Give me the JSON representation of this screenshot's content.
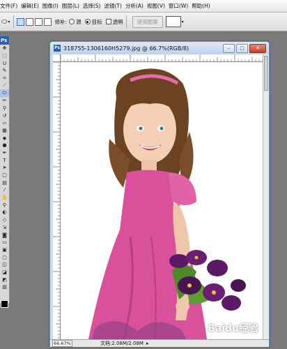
{
  "menu": [
    {
      "label": "文件(F)"
    },
    {
      "label": "编辑(E)"
    },
    {
      "label": "图像(I)"
    },
    {
      "label": "图层(L)"
    },
    {
      "label": "选择(S)"
    },
    {
      "label": "滤镜(T)"
    },
    {
      "label": "分析(A)"
    },
    {
      "label": "视图(V)"
    },
    {
      "label": "窗口(W)"
    },
    {
      "label": "帮助(H)"
    }
  ],
  "options": {
    "feather_label": "修补:",
    "source_label": "源",
    "destination_label": "目标",
    "destination_selected": true,
    "transparent_label": "透明",
    "use_pattern_label": "使用图案"
  },
  "toolbox": {
    "header": "Ps",
    "tools": [
      "move",
      "marquee",
      "lasso",
      "quick-select",
      "crop",
      "slice",
      "heal",
      "brush",
      "stamp",
      "history-brush",
      "eraser",
      "gradient",
      "blur",
      "dodge",
      "pen",
      "type",
      "path-select",
      "shape",
      "notes",
      "eyedropper",
      "hand",
      "zoom"
    ]
  },
  "document": {
    "title": "318755-1306160H5279.jpg @ 66.7%(RGB/8)",
    "zoom": "66.67%",
    "doc_size": "文档:2.08M/2.08M"
  },
  "watermark": "Baidu经验",
  "colors": {
    "dress": "#d9519b",
    "flowers": "#5c1a66",
    "accent": "#2d5ea8"
  }
}
